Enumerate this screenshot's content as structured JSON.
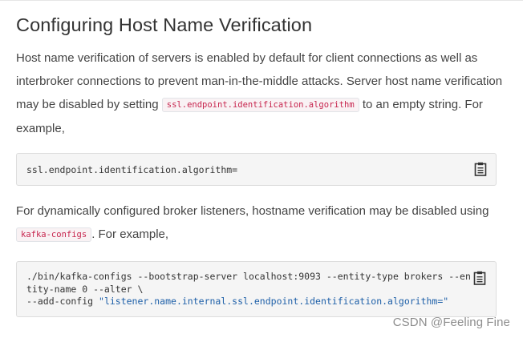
{
  "heading": "Configuring Host Name Verification",
  "paragraph1": {
    "before": "Host name verification of servers is enabled by default for client connections as well as interbroker connections to prevent man-in-the-middle attacks. Server host name verification may be disabled by setting ",
    "code": "ssl.endpoint.identification.algorithm",
    "after": " to an empty string. For example,"
  },
  "code_block_1": {
    "line": "ssl.endpoint.identification.algorithm=",
    "copy_icon": "clipboard-icon"
  },
  "paragraph2": {
    "before": "For dynamically configured broker listeners, hostname verification may be disabled using ",
    "code": "kafka-configs",
    "after": ". For example,"
  },
  "code_block_2": {
    "line1": "./bin/kafka-configs --bootstrap-server localhost:9093 --entity-type brokers --en",
    "line2": "tity-name 0 --alter \\",
    "line3_prefix": "--add-config ",
    "line3_string": "\"listener.name.internal.ssl.endpoint.identification.algorithm=\"",
    "copy_icon": "clipboard-icon"
  },
  "watermark": "CSDN @Feeling Fine",
  "colors": {
    "inline_code": "#c7254e",
    "string_literal": "#1d5fa8",
    "code_background": "#f5f5f5"
  }
}
